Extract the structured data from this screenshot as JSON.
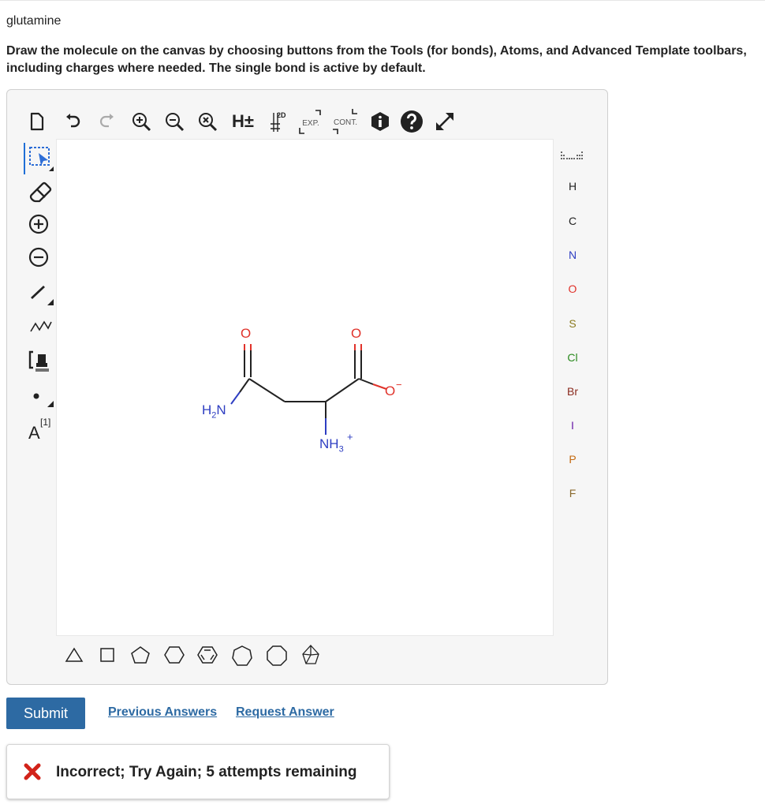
{
  "question": {
    "title": "glutamine",
    "instructions": "Draw the molecule on the canvas by choosing buttons from the Tools (for bonds), Atoms, and Advanced Template toolbars, including charges where needed. The single bond is active by default."
  },
  "top_toolbar": {
    "buttons": [
      "new-document-icon",
      "undo-icon",
      "redo-icon",
      "zoom-in-icon",
      "zoom-out-icon",
      "zoom-reset-icon",
      "add-hydrogens-icon",
      "clean-2d-icon",
      "expand-icon",
      "contract-icon",
      "info-icon",
      "help-icon",
      "fullscreen-icon"
    ],
    "h_label": "H±",
    "clean_label": "2D",
    "expand_label": "EXP.",
    "contract_label": "CONT."
  },
  "left_toolbar": {
    "buttons": [
      "selection-icon",
      "eraser-icon",
      "positive-charge-icon",
      "negative-charge-icon",
      "single-bond-icon",
      "chain-icon",
      "bracket-icon",
      "radical-dot-icon",
      "atom-map-icon"
    ],
    "atom_map_label": "A",
    "atom_map_index": "[1]"
  },
  "atoms_toolbar": {
    "periodic_table_icon": "periodic-table-icon",
    "atoms": [
      {
        "symbol": "H",
        "color": "#222222"
      },
      {
        "symbol": "C",
        "color": "#222222"
      },
      {
        "symbol": "N",
        "color": "#2e3ec2"
      },
      {
        "symbol": "O",
        "color": "#e0322a"
      },
      {
        "symbol": "S",
        "color": "#8a7a1e"
      },
      {
        "symbol": "Cl",
        "color": "#2a8a1e"
      },
      {
        "symbol": "Br",
        "color": "#8a2a1e"
      },
      {
        "symbol": "I",
        "color": "#6a1aa8"
      },
      {
        "symbol": "P",
        "color": "#c46a10"
      },
      {
        "symbol": "F",
        "color": "#8a6a2e"
      }
    ]
  },
  "template_toolbar": {
    "templates": [
      "triangle-template-icon",
      "square-template-icon",
      "pentagon-template-icon",
      "hexagon-template-icon",
      "benzene-template-icon",
      "heptagon-template-icon",
      "octagon-template-icon",
      "bicyclic-template-icon"
    ]
  },
  "molecule": {
    "atoms": {
      "amide_o": "O",
      "amide_n": "H2N",
      "carboxyl_o_double": "O",
      "carboxyl_o_single": "O",
      "carboxyl_charge": "−",
      "amino_n": "NH3",
      "amino_charge": "+"
    }
  },
  "actions": {
    "submit_label": "Submit",
    "previous_answers_label": "Previous Answers",
    "request_answer_label": "Request Answer"
  },
  "feedback": {
    "icon": "x-mark-icon",
    "message": "Incorrect; Try Again; 5 attempts remaining",
    "color": "#d2231a"
  }
}
